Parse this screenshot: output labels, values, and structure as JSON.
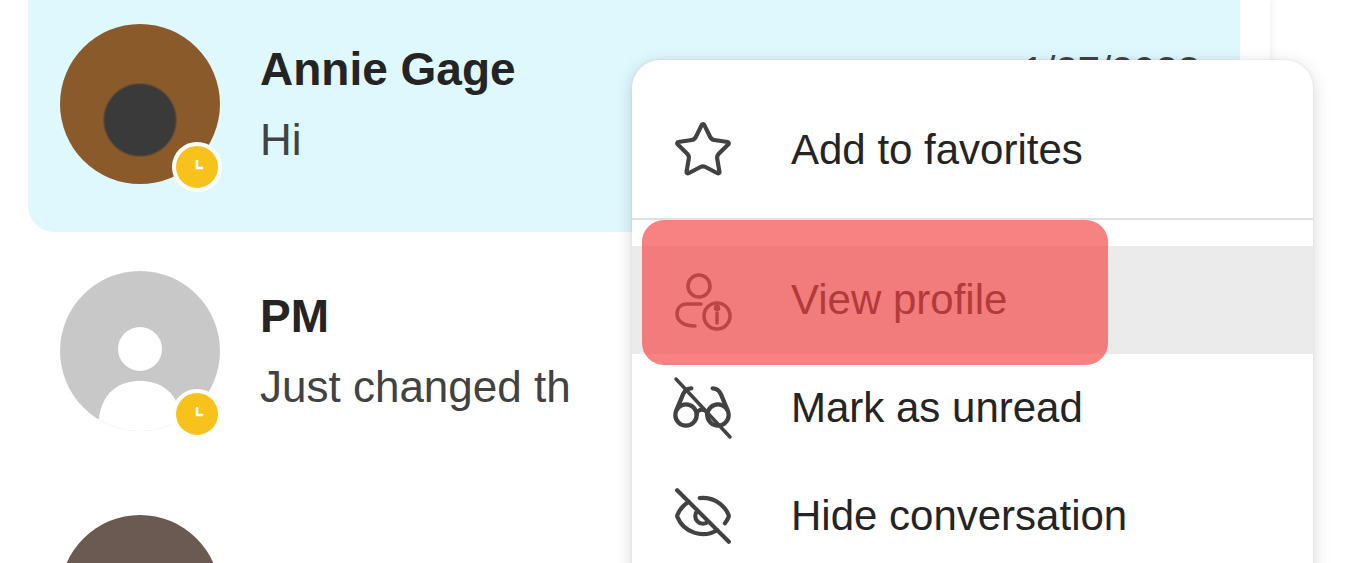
{
  "conversations": [
    {
      "name": "Annie Gage",
      "preview": "Hi",
      "time": "1/27/2023",
      "selected": true,
      "avatar": "photo",
      "photo_color": "#8a5a2b",
      "presence": "away"
    },
    {
      "name": "PM",
      "preview": "Just changed th",
      "selected": false,
      "avatar": "placeholder",
      "presence": "away"
    },
    {
      "selected": false,
      "avatar": "photo",
      "photo_color": "#6b5a52",
      "presence": "none"
    }
  ],
  "context_menu": {
    "items": [
      {
        "label": "Add to favorites",
        "kind": "star",
        "hovered": false,
        "highlighted": false,
        "divider_after": true
      },
      {
        "label": "View profile",
        "kind": "profile",
        "hovered": true,
        "highlighted": true,
        "divider_after": false
      },
      {
        "label": "Mark as unread",
        "kind": "unread",
        "hovered": false,
        "highlighted": false,
        "divider_after": false
      },
      {
        "label": "Hide conversation",
        "kind": "hide",
        "hovered": false,
        "highlighted": false,
        "divider_after": false
      }
    ]
  }
}
